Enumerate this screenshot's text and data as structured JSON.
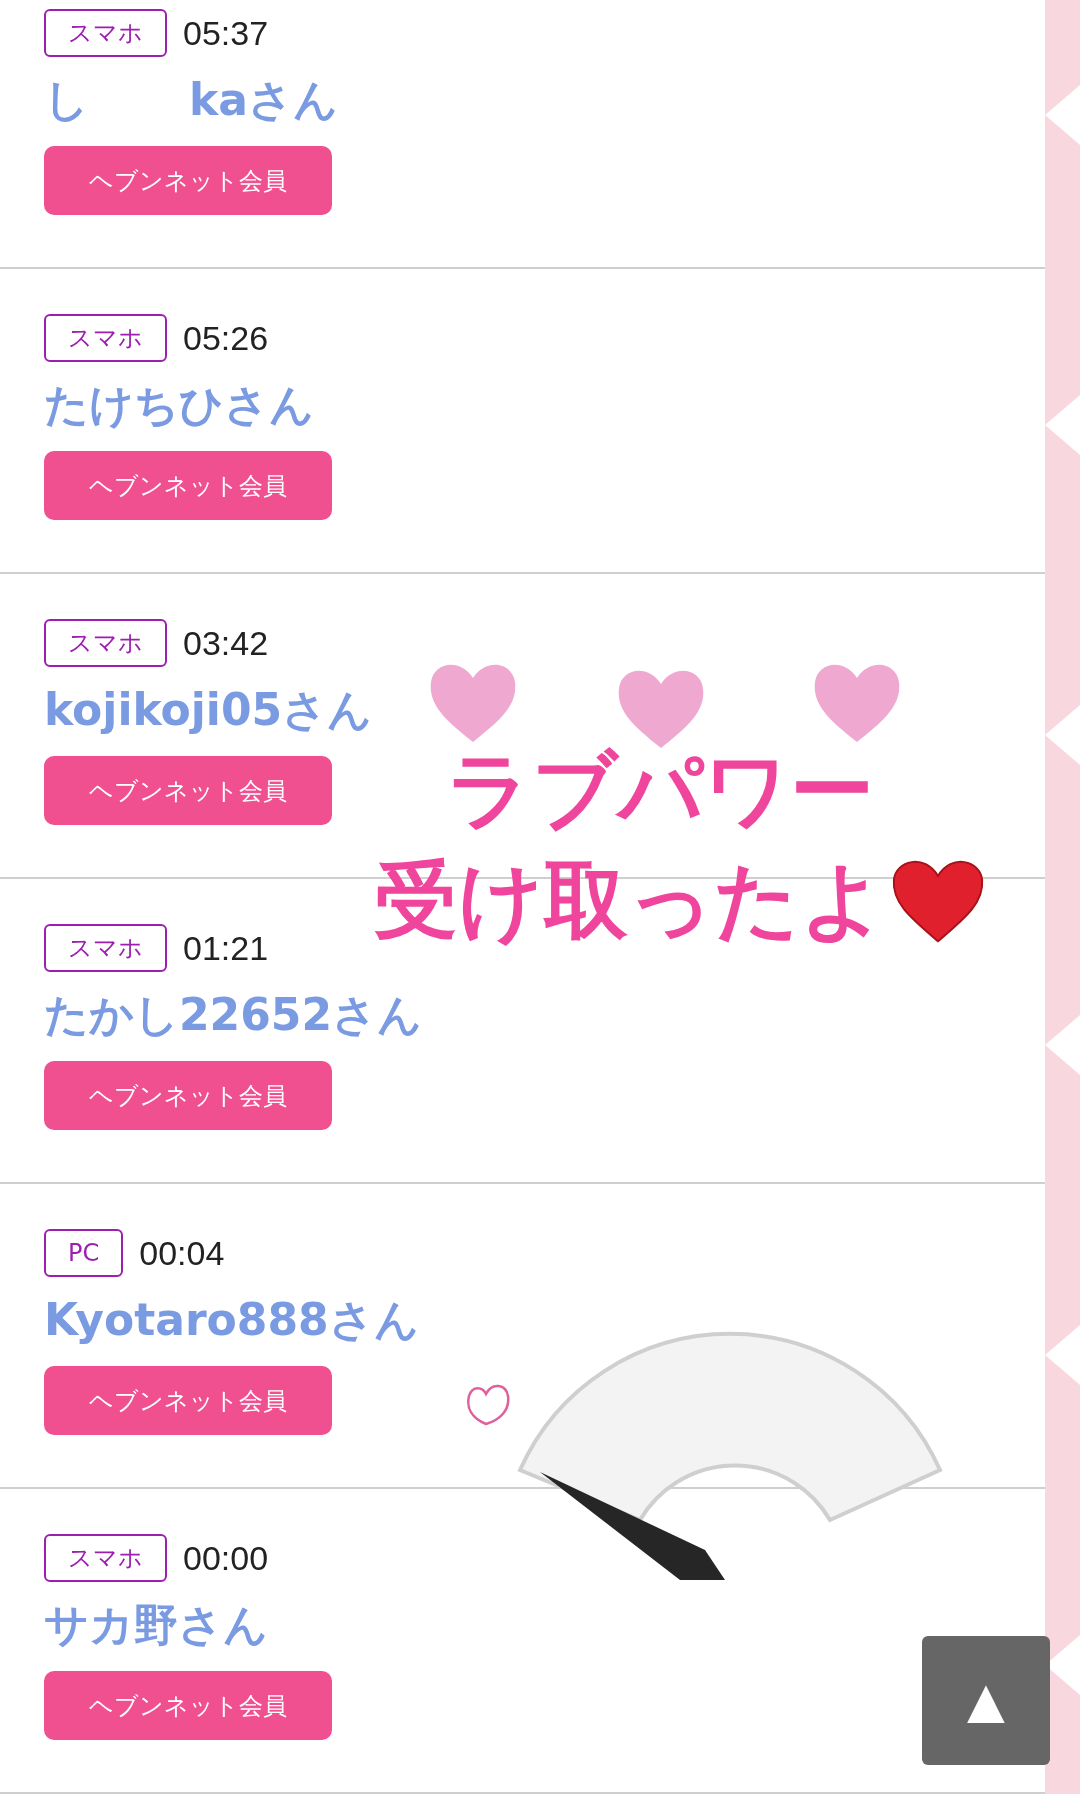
{
  "members": [
    {
      "device": "スマホ",
      "time": "05:37",
      "name_parts": [
        "し",
        "kaさん"
      ],
      "membership": "ヘブンネット会員"
    },
    {
      "device": "スマホ",
      "time": "05:26",
      "name_parts": [
        "たけちひさん"
      ],
      "membership": "ヘブンネット会員"
    },
    {
      "device": "スマホ",
      "time": "03:42",
      "name_parts": [
        "kojikoji05さん"
      ],
      "membership": "ヘブンネット会員"
    },
    {
      "device": "スマホ",
      "time": "01:21",
      "name_parts": [
        "たかし22652さん"
      ],
      "membership": "ヘブンネット会員"
    },
    {
      "device": "PC",
      "time": "00:04",
      "name_parts": [
        "Kyotaro888さん"
      ],
      "membership": "ヘブンネット会員"
    },
    {
      "device": "スマホ",
      "time": "00:00",
      "name_parts": [
        "サカ野さん"
      ],
      "membership": "ヘブンネット会員"
    }
  ],
  "overlay_text": [
    "ラブパワー",
    "受け取ったよ"
  ],
  "scroll_top": "▲"
}
